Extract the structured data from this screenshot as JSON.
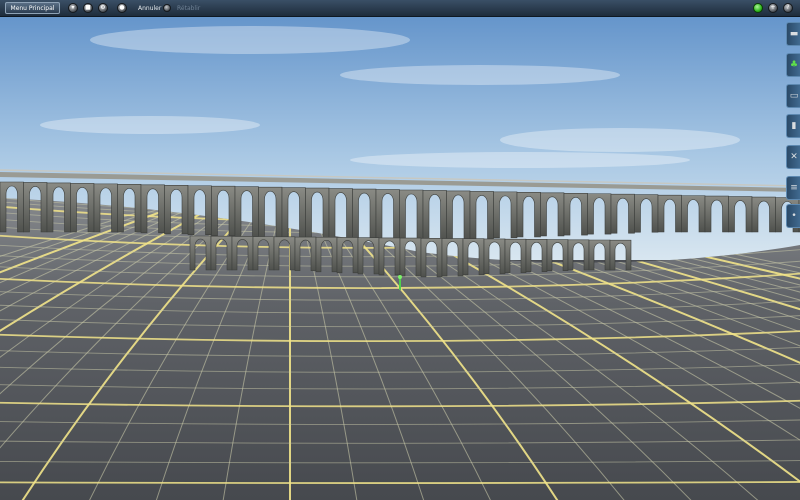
{
  "toolbar": {
    "menu_button_label": "Menu Principal",
    "left_icons": [
      "view-icon",
      "stop-icon",
      "settings-icon",
      "circle-icon"
    ],
    "undo_label": "Annuler",
    "redo_label": "Rétablir",
    "right_icons": [
      "status-green-icon",
      "add-icon",
      "help-icon"
    ]
  },
  "side_panel": {
    "tabs": [
      {
        "name": "tab-track",
        "icon": "track-icon"
      },
      {
        "name": "tab-objects",
        "icon": "tree-icon"
      },
      {
        "name": "tab-trains",
        "icon": "train-icon"
      },
      {
        "name": "tab-vehicles",
        "icon": "vehicle-icon"
      },
      {
        "name": "tab-tools",
        "icon": "wrench-icon"
      },
      {
        "name": "tab-interlocking",
        "icon": "rail-icon"
      },
      {
        "name": "tab-more",
        "icon": "dot-icon"
      }
    ]
  },
  "colors": {
    "sky_top": "#5d8fc8",
    "sky_bottom": "#cfe1ef",
    "terrain": "#5a5d62",
    "grid_minor": "#c8c8a8",
    "grid_major": "#f2e48a",
    "stone": "#6d6f6a",
    "toolbar": "#2a3d52",
    "accent_green": "#36c21f"
  }
}
